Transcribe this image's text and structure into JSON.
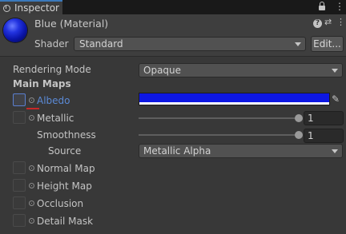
{
  "tab": {
    "title": "Inspector",
    "menu_glyph": "⋮"
  },
  "material": {
    "name": "Blue (Material)",
    "color": "#0d17e3",
    "help_glyph": "?",
    "preset_glyph": "⇄",
    "menu_glyph": "⋮"
  },
  "shader": {
    "label": "Shader",
    "value": "Standard",
    "edit_label": "Edit..."
  },
  "rendering_mode": {
    "label": "Rendering Mode",
    "value": "Opaque"
  },
  "main_maps": {
    "title": "Main Maps",
    "albedo": {
      "label": "Albedo",
      "color": "#0d17e3",
      "eyedropper_glyph": "✎"
    },
    "metallic": {
      "label": "Metallic",
      "value": "1",
      "fraction": 1.0
    },
    "smoothness": {
      "label": "Smoothness",
      "value": "1",
      "fraction": 1.0
    },
    "source": {
      "label": "Source",
      "value": "Metallic Alpha"
    },
    "normal_map": {
      "label": "Normal Map"
    },
    "height_map": {
      "label": "Height Map"
    },
    "occlusion": {
      "label": "Occlusion"
    },
    "detail_mask": {
      "label": "Detail Mask"
    }
  }
}
